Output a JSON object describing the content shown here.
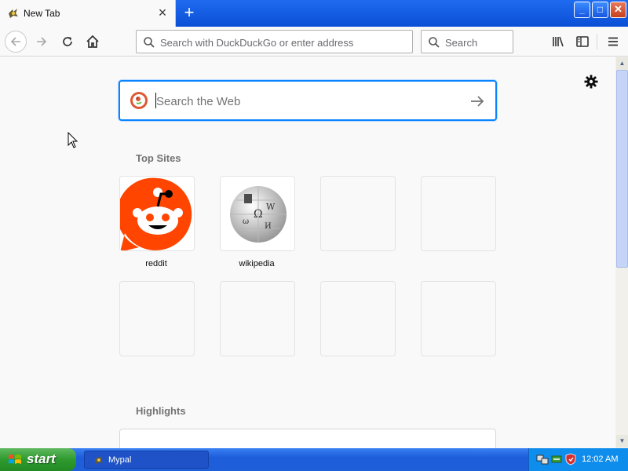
{
  "browser": {
    "tab": {
      "title": "New Tab",
      "close": "×",
      "favicon": "mypal-icon"
    },
    "new_tab_label": "+",
    "window": {
      "minimize": "_",
      "maximize": "□",
      "close": "✕"
    },
    "urlbar": {
      "placeholder": "Search with DuckDuckGo or enter address",
      "value": ""
    },
    "searchbar": {
      "placeholder": "Search",
      "value": ""
    }
  },
  "newtab": {
    "search": {
      "placeholder": "Search the Web",
      "value": ""
    },
    "top_sites_title": "Top Sites",
    "top_sites": [
      {
        "label": "reddit",
        "icon": "reddit-icon"
      },
      {
        "label": "wikipedia",
        "icon": "wikipedia-icon"
      },
      {
        "label": "",
        "icon": ""
      },
      {
        "label": "",
        "icon": ""
      },
      {
        "label": "",
        "icon": ""
      },
      {
        "label": "",
        "icon": ""
      },
      {
        "label": "",
        "icon": ""
      },
      {
        "label": "",
        "icon": ""
      }
    ],
    "highlights_title": "Highlights"
  },
  "taskbar": {
    "start_label": "start",
    "task_label": "Mypal",
    "clock": "12:02 AM"
  },
  "colors": {
    "accent": "#0a84ff",
    "titlebar": "#0a4fd6",
    "taskbar": "#1f5fd8",
    "start": "#2e9a2e",
    "reddit": "#ff4500"
  }
}
